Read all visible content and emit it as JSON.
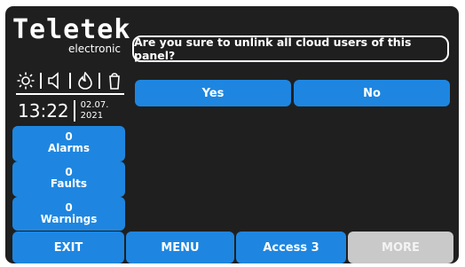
{
  "brand": {
    "name": "Teletek",
    "subtitle": "electronic"
  },
  "status_icons": [
    "sun-icon",
    "speaker-icon",
    "fire-icon",
    "trash-bin-icon"
  ],
  "clock": {
    "time": "13:22",
    "date_line1": "02.07.",
    "date_line2": "2021"
  },
  "side_panel": {
    "alarms": {
      "count": "0",
      "label": "Alarms"
    },
    "faults": {
      "count": "0",
      "label": "Faults"
    },
    "warnings": {
      "count": "0",
      "label": "Warnings"
    }
  },
  "dialog": {
    "question": "Are you sure to unlink all cloud users of this panel?",
    "yes_label": "Yes",
    "no_label": "No"
  },
  "bottom_bar": {
    "exit": "EXIT",
    "menu": "MENU",
    "access": "Access 3",
    "more": "MORE"
  },
  "colors": {
    "background": "#1f1f1f",
    "button": "#1e86e0",
    "disabled": "#c9c9c9",
    "text": "#ffffff"
  }
}
